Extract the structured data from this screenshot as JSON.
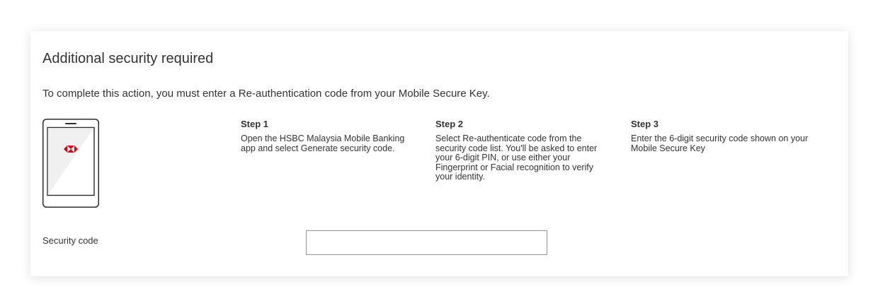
{
  "dialog": {
    "title": "Additional security required",
    "intro": "To complete this action, you must enter a Re-authentication code from your Mobile Secure Key."
  },
  "illustration": {
    "icon": "phone-with-hsbc-logo-icon",
    "brand_color": "#db0011"
  },
  "steps": [
    {
      "heading": "Step 1",
      "text": "Open the HSBC Malaysia Mobile Banking app and select Generate security code."
    },
    {
      "heading": "Step 2",
      "text": "Select Re-authenticate code from the security code list. You'll be asked to enter your 6-digit PIN, or use either your Fingerprint or Facial recognition to verify your identity."
    },
    {
      "heading": "Step 3",
      "text": "Enter the 6-digit security code shown on your Mobile Secure Key"
    }
  ],
  "security_code": {
    "label": "Security code",
    "value": "",
    "placeholder": ""
  }
}
